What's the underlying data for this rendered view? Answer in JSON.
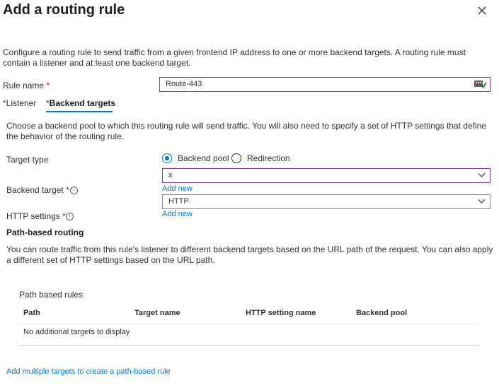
{
  "panel": {
    "title": "Add a routing rule",
    "description": "Configure a routing rule to send traffic from a given frontend IP address to one or more backend targets. A routing rule must contain a listener and at least one backend target."
  },
  "rule_name": {
    "label": "Rule name",
    "required_marker": "*",
    "value": "Route-443",
    "validation_icon": "checkmark-icon"
  },
  "tabs": [
    {
      "required_marker": "*",
      "label": "Listener",
      "selected": false
    },
    {
      "required_marker": "*",
      "label": "Backend targets",
      "selected": true
    }
  ],
  "backend": {
    "description": "Choose a backend pool to which this routing rule will send traffic. You will also need to specify a set of HTTP settings that define the behavior of the routing rule.",
    "target_type": {
      "label": "Target type",
      "options": [
        {
          "label": "Backend pool",
          "selected": true
        },
        {
          "label": "Redirection",
          "selected": false
        }
      ]
    },
    "backend_target": {
      "label": "Backend target",
      "required_marker": "*",
      "value": "x",
      "add_new": "Add new",
      "info_icon": "info-icon"
    },
    "http_settings": {
      "label": "HTTP settings",
      "required_marker": "*",
      "value": "HTTP",
      "add_new": "Add new",
      "info_icon": "info-icon"
    }
  },
  "path_routing": {
    "heading": "Path-based routing",
    "description": "You can route traffic from this rule's listener to different backend targets based on the URL path of the request. You can also apply a different set of HTTP settings based on the URL path.",
    "table": {
      "title": "Path based rules",
      "columns": [
        "Path",
        "Target name",
        "HTTP setting name",
        "Backend pool"
      ],
      "empty_text": "No additional targets to display"
    },
    "add_multiple_link": "Add multiple targets to create a path-based rule"
  },
  "colors": {
    "accent": "#0078d4",
    "invalid_border": "#8a3c9e",
    "required": "#a4262c"
  }
}
